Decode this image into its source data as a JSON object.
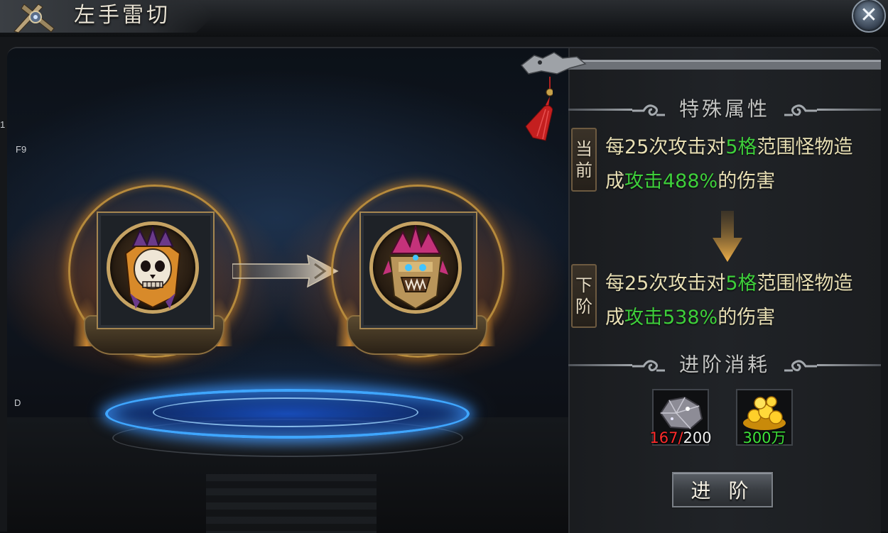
{
  "window": {
    "title": "左手雷切",
    "close_icon": "close-icon"
  },
  "side_labels": [
    "1",
    "F9",
    "D"
  ],
  "upgrade": {
    "current_item": {
      "name": "skull-gauntlet-item"
    },
    "next_item": {
      "name": "dragon-gauntlet-item"
    }
  },
  "special_attributes": {
    "header": "特殊属性",
    "current": {
      "tag": [
        "当",
        "前"
      ],
      "line1_pre": "每25次攻击对",
      "line1_hl": "5格",
      "line1_post": "范围怪物造",
      "line2_pre": "成",
      "line2_hl": "攻击488%",
      "line2_post": "的伤害"
    },
    "next": {
      "tag": [
        "下",
        "阶"
      ],
      "line1_pre": "每25次攻击对",
      "line1_hl": "5格",
      "line1_post": "范围怪物造",
      "line2_pre": "成",
      "line2_hl": "攻击538%",
      "line2_post": "的伤害"
    }
  },
  "cost": {
    "header": "进阶消耗",
    "items": [
      {
        "icon": "ore-icon",
        "have": "167/",
        "need": "200"
      },
      {
        "icon": "gold-coins-icon",
        "amount": "300万"
      }
    ]
  },
  "advance_button": "进 阶",
  "colors": {
    "highlight_green": "#3ecf3b",
    "insufficient_red": "#ff2b2b",
    "text_cream": "#e8dfb4",
    "ring_blue": "#3fa6ff"
  }
}
